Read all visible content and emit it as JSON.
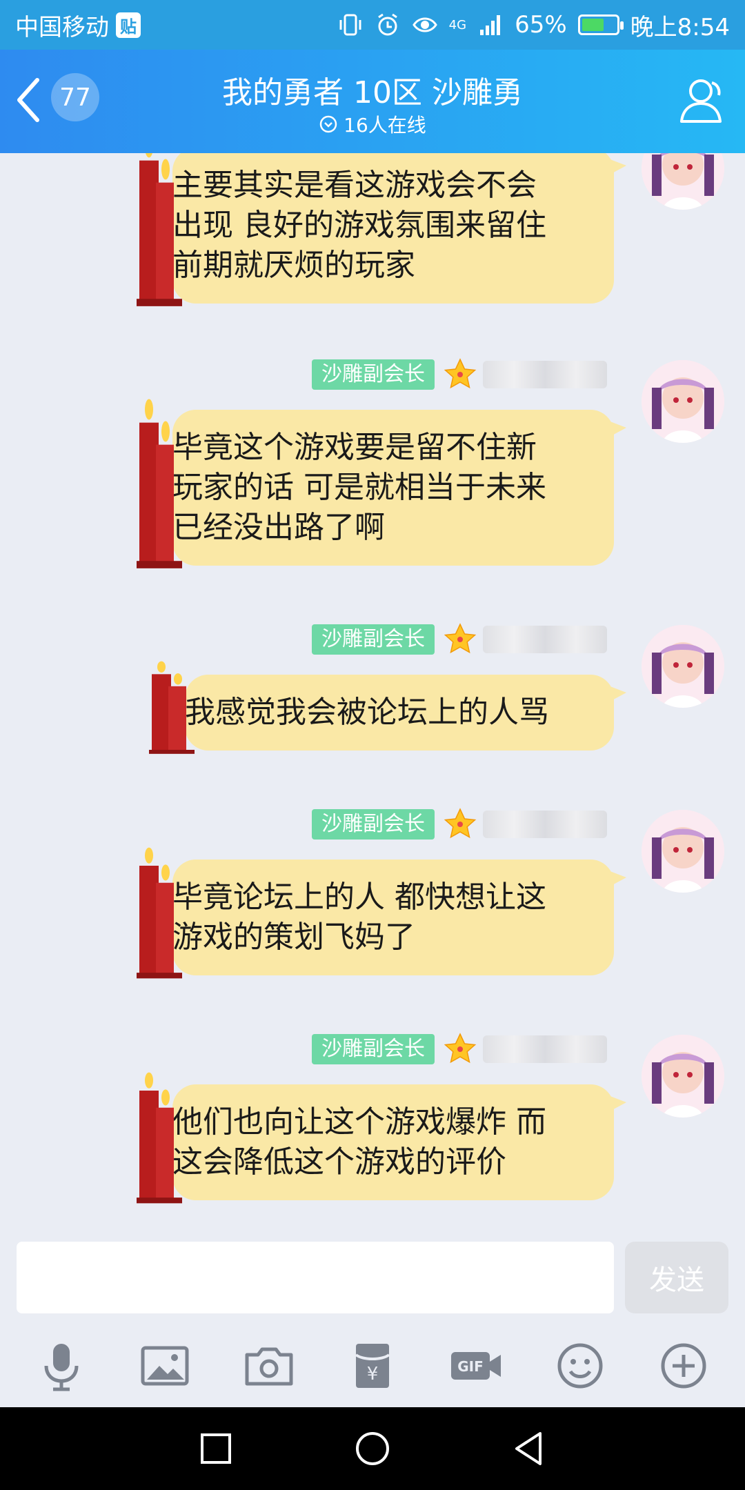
{
  "status_bar": {
    "carrier": "中国移动",
    "carrier_tag": "贴",
    "network": "4G",
    "battery": "65%",
    "time": "晚上8:54",
    "icons": [
      "vibrate-icon",
      "alarm-icon",
      "eye-icon",
      "signal-icon",
      "battery-icon"
    ]
  },
  "header": {
    "back_icon": "chevron-left-icon",
    "unread_count": "77",
    "title": "我的勇者 10区 沙雕勇",
    "online": "16人在线",
    "right_icon": "group-members-icon"
  },
  "messages": [
    {
      "text": "主要其实是看这游戏会不会\n出现 良好的游戏氛围来留住\n前期就厌烦的玩家"
    },
    {
      "role": "沙雕副会长",
      "text": "毕竟这个游戏要是留不住新\n玩家的话 可是就相当于未来\n已经没出路了啊"
    },
    {
      "role": "沙雕副会长",
      "text": "我感觉我会被论坛上的人骂"
    },
    {
      "role": "沙雕副会长",
      "text": "毕竟论坛上的人 都快想让这\n游戏的策划飞妈了"
    },
    {
      "role": "沙雕副会长",
      "text": "他们也向让这个游戏爆炸 而\n这会降低这个游戏的评价"
    }
  ],
  "input": {
    "value": "",
    "send_label": "发送"
  },
  "toolbar": [
    "microphone-icon",
    "image-icon",
    "camera-icon",
    "red-packet-icon",
    "gif-icon",
    "emoji-icon",
    "plus-icon"
  ],
  "colors": {
    "header_start": "#2e8bf0",
    "header_end": "#26b8f4",
    "bubble": "#fae8a6",
    "role_tag": "#6dd8a5"
  }
}
